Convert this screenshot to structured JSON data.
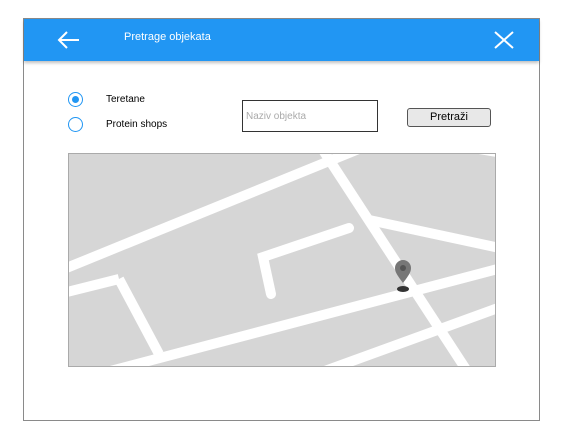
{
  "header": {
    "title": "Pretrage objekata",
    "background_color": "#2196f3"
  },
  "filters": {
    "options": [
      {
        "label": "Teretane",
        "selected": true
      },
      {
        "label": "Protein shops",
        "selected": false
      }
    ]
  },
  "search": {
    "placeholder": "Naziv objekta",
    "value": "",
    "button_label": "Pretraži"
  },
  "icons": {
    "back": "arrow-left-icon",
    "close": "close-icon",
    "marker": "map-pin-icon"
  }
}
